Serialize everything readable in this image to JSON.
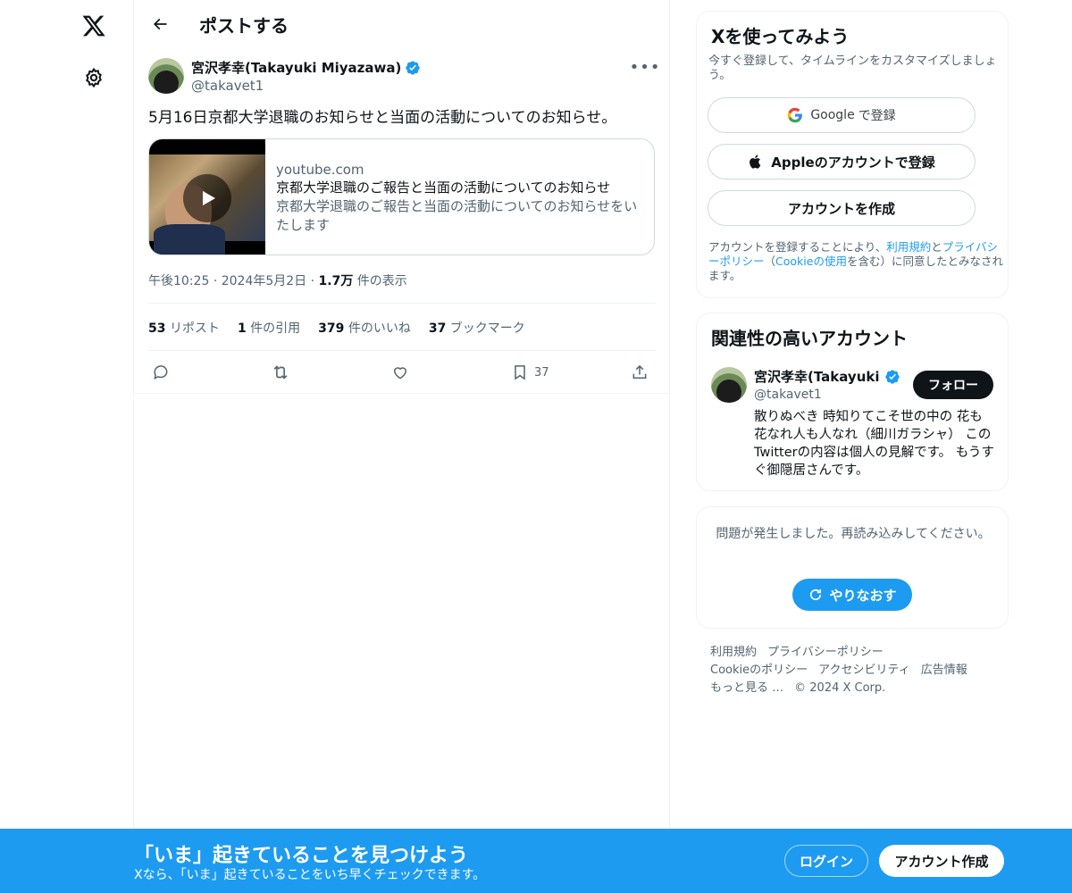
{
  "nav": {
    "logo_icon": "x-logo-icon",
    "settings_icon": "gear-icon"
  },
  "header": {
    "title": "ポストする"
  },
  "post": {
    "author_name": "宮沢孝幸(Takayuki Miyazawa)",
    "author_handle": "@takavet1",
    "text": "5月16日京都大学退職のお知らせと当面の活動についてのお知らせ。",
    "card": {
      "domain": "youtube.com",
      "title": "京都大学退職のご報告と当面の活動についてのお知らせ",
      "description": "京都大学退職のご報告と当面の活動についてのお知らせをいたします"
    },
    "time": "午後10:25",
    "date": "2024年5月2日",
    "views_count": "1.7万",
    "views_label": "件の表示",
    "stats": {
      "reposts_count": "53",
      "reposts_label": "リポスト",
      "quotes_count": "1",
      "quotes_label": "件の引用",
      "likes_count": "379",
      "likes_label": "件のいいね",
      "bookmarks_count": "37",
      "bookmarks_label": "ブックマーク"
    },
    "bookmark_action_count": "37"
  },
  "signup": {
    "title": "Xを使ってみよう",
    "subtitle": "今すぐ登録して、タイムラインをカスタマイズしましょう。",
    "google_label": "で登録",
    "google_brand": "Google",
    "apple_label": "Appleのアカウントで登録",
    "create_label": "アカウントを作成",
    "legal_pre": "アカウントを登録することにより、",
    "legal_terms": "利用規約",
    "legal_and": "と",
    "legal_privacy": "プライバシーポリシー",
    "legal_mid": "（",
    "legal_cookie": "Cookieの使用",
    "legal_post": "を含む）に同意したとみなされます。"
  },
  "related": {
    "title": "関連性の高いアカウント",
    "name": "宮沢孝幸(Takayuki Miyazawa)",
    "handle": "@takavet1",
    "follow_label": "フォロー",
    "bio": "散りぬべき 時知りてこそ世の中の 花も花なれ人も人なれ（細川ガラシャ） このTwitterの内容は個人の見解です。 もうすぐ御隠居さんです。"
  },
  "error": {
    "message": "問題が発生しました。再読み込みしてください。",
    "retry_label": "やりなおす"
  },
  "footer": {
    "terms": "利用規約",
    "privacy": "プライバシーポリシー",
    "cookie": "Cookieのポリシー",
    "accessibility": "アクセシビリティ",
    "ads": "広告情報",
    "more": "もっと見る …",
    "copyright": "© 2024 X Corp."
  },
  "banner": {
    "title": "「いま」起きていることを見つけよう",
    "subtitle": "Xなら、「いま」起きていることをいち早くチェックできます。",
    "login_label": "ログイン",
    "signup_label": "アカウント作成"
  },
  "colors": {
    "accent": "#1d9bf0",
    "text": "#0f1419",
    "muted": "#536471",
    "border": "#eff3f4"
  }
}
